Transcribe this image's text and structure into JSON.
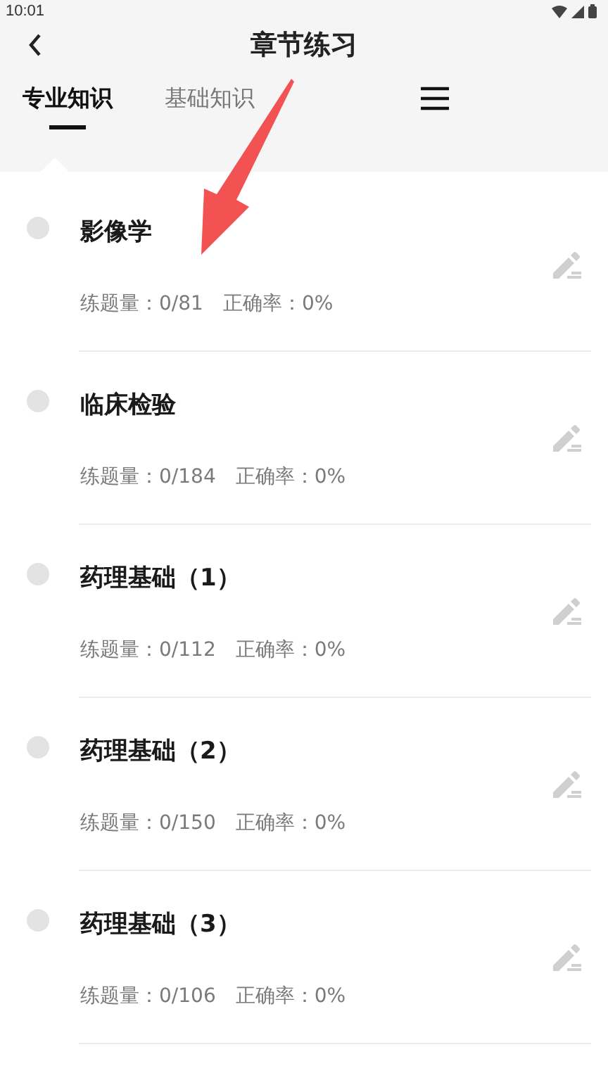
{
  "status_bar": {
    "time": "10:01"
  },
  "header": {
    "title": "章节练习"
  },
  "tabs": [
    {
      "label": "专业知识",
      "selected": true
    },
    {
      "label": "基础知识",
      "selected": false
    }
  ],
  "chapters": [
    {
      "title": "影像学",
      "count_label": "练题量：",
      "count": "0/81",
      "accuracy_label": "正确率：",
      "accuracy": "0%"
    },
    {
      "title": "临床检验",
      "count_label": "练题量：",
      "count": "0/184",
      "accuracy_label": "正确率：",
      "accuracy": "0%"
    },
    {
      "title": "药理基础（1）",
      "count_label": "练题量：",
      "count": "0/112",
      "accuracy_label": "正确率：",
      "accuracy": "0%"
    },
    {
      "title": "药理基础（2）",
      "count_label": "练题量：",
      "count": "0/150",
      "accuracy_label": "正确率：",
      "accuracy": "0%"
    },
    {
      "title": "药理基础（3）",
      "count_label": "练题量：",
      "count": "0/106",
      "accuracy_label": "正确率：",
      "accuracy": "0%"
    }
  ]
}
